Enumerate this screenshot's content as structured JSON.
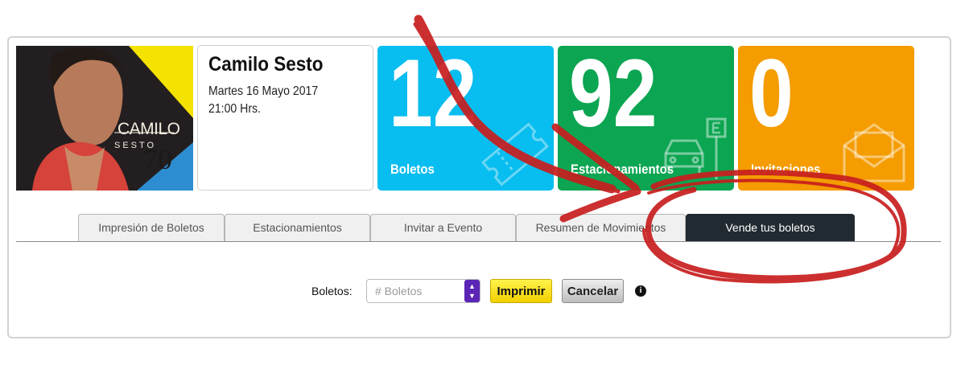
{
  "event": {
    "cover_title": "CAMILO",
    "cover_subtitle": "SESTO",
    "cover_number": "70",
    "title": "Camilo Sesto",
    "date": "Martes 16 Mayo 2017",
    "time": "21:00 Hrs."
  },
  "stats": [
    {
      "value": "12",
      "label": "Boletos",
      "color": "#08bdef",
      "icon": "ticket-icon"
    },
    {
      "value": "92",
      "label": "Estacionamientos",
      "color": "#0ca552",
      "icon": "car-parking-icon"
    },
    {
      "value": "0",
      "label": "Invitaciones",
      "color": "#f49c00",
      "icon": "envelope-icon"
    }
  ],
  "tabs": [
    {
      "label": "Impresión de Boletos",
      "active": false
    },
    {
      "label": "Estacionamientos",
      "active": false
    },
    {
      "label": "Invitar a Evento",
      "active": false
    },
    {
      "label": "Resumen de Movimientos",
      "active": false
    },
    {
      "label": "Vende tus boletos",
      "active": true
    }
  ],
  "form": {
    "label": "Boletos:",
    "placeholder": "# Boletos",
    "print_label": "Imprimir",
    "cancel_label": "Cancelar",
    "info_glyph": "i"
  },
  "colors": {
    "annotation": "#c81e1e",
    "active_tab": "#212a31",
    "spinner": "#5b25b5",
    "print_button": "#f6dc00"
  }
}
